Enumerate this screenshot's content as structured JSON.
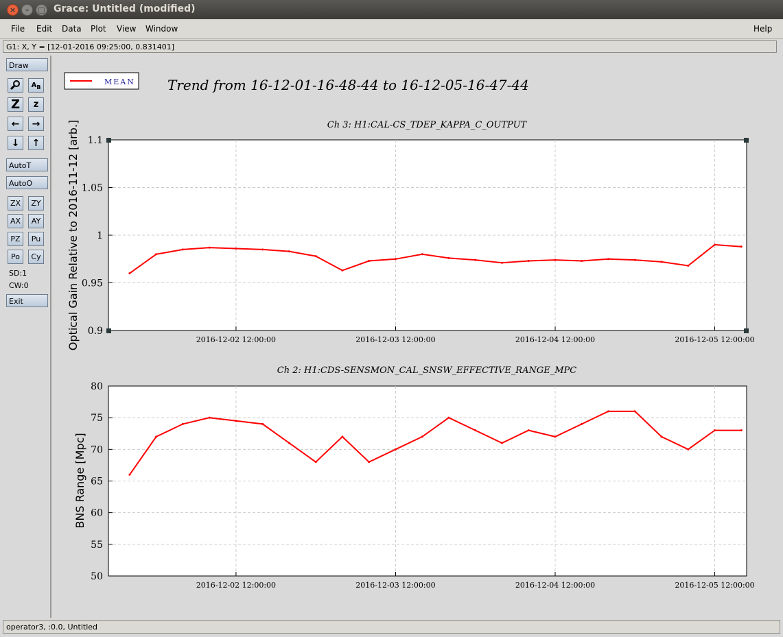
{
  "window": {
    "title": "Grace: Untitled (modified)"
  },
  "menu": {
    "file": "File",
    "edit": "Edit",
    "data": "Data",
    "plot": "Plot",
    "view": "View",
    "window": "Window",
    "help": "Help"
  },
  "coord_readout": "G1: X, Y = [12-01-2016 09:25:00, 0.831401]",
  "toolbar": {
    "draw": "Draw",
    "autot": "AutoT",
    "autoo": "AutoO",
    "zx": "ZX",
    "zy": "ZY",
    "ax": "AX",
    "ay": "AY",
    "pz": "PZ",
    "pu": "Pu",
    "po": "Po",
    "cy": "Cy",
    "sd": "SD:1",
    "cw": "CW:0",
    "exit": "Exit",
    "icons": [
      "zoom-icon",
      "autoscale-text-icon",
      "zoom-z-large-icon",
      "zoom-z-small-icon",
      "arrow-left-icon",
      "arrow-right-icon",
      "arrow-down-icon",
      "arrow-up-icon"
    ]
  },
  "status": "operator3, :0.0, Untitled",
  "figure": {
    "title": "Trend from 16-12-01-16-48-44 to 16-12-05-16-47-44",
    "legend": "MEAN",
    "line_color": "#ff0000"
  },
  "chart_data": [
    {
      "type": "line",
      "title": "Ch 3: H1:CAL-CS_TDEP_KAPPA_C_OUTPUT",
      "ylabel": "Optical Gain Relative to 2016-11-12 [arb.]",
      "xlabel": "",
      "ylim": [
        0.9,
        1.1
      ],
      "yticks": [
        "0.9",
        "0.95",
        "1",
        "1.05",
        "1.1"
      ],
      "xticks": [
        "2016-12-02 12:00:00",
        "2016-12-03 12:00:00",
        "2016-12-04 12:00:00",
        "2016-12-05 12:00:00"
      ],
      "grid": true,
      "series": [
        {
          "name": "MEAN",
          "x": [
            "2016-12-01 20:00",
            "2016-12-02 00:00",
            "2016-12-02 04:00",
            "2016-12-02 08:00",
            "2016-12-02 12:00",
            "2016-12-02 16:00",
            "2016-12-02 20:00",
            "2016-12-03 00:00",
            "2016-12-03 04:00",
            "2016-12-03 08:00",
            "2016-12-03 12:00",
            "2016-12-03 16:00",
            "2016-12-03 20:00",
            "2016-12-04 00:00",
            "2016-12-04 04:00",
            "2016-12-04 08:00",
            "2016-12-04 12:00",
            "2016-12-04 16:00",
            "2016-12-04 20:00",
            "2016-12-05 00:00",
            "2016-12-05 04:00",
            "2016-12-05 08:00",
            "2016-12-05 12:00",
            "2016-12-05 16:00"
          ],
          "values": [
            0.96,
            0.98,
            0.985,
            0.987,
            0.986,
            0.985,
            0.983,
            0.978,
            0.963,
            0.973,
            0.975,
            0.98,
            0.976,
            0.974,
            0.971,
            0.973,
            0.974,
            0.973,
            0.975,
            0.974,
            0.972,
            0.968,
            0.99,
            0.988
          ]
        }
      ]
    },
    {
      "type": "line",
      "title": "Ch 2: H1:CDS-SENSMON_CAL_SNSW_EFFECTIVE_RANGE_MPC",
      "ylabel": "BNS Range [Mpc]",
      "xlabel": "",
      "ylim": [
        50,
        80
      ],
      "yticks": [
        "50",
        "55",
        "60",
        "65",
        "70",
        "75",
        "80"
      ],
      "xticks": [
        "2016-12-02 12:00:00",
        "2016-12-03 12:00:00",
        "2016-12-04 12:00:00",
        "2016-12-05 12:00:00"
      ],
      "grid": true,
      "series": [
        {
          "name": "MEAN",
          "x": [
            "2016-12-01 20:00",
            "2016-12-02 00:00",
            "2016-12-02 04:00",
            "2016-12-02 08:00",
            "2016-12-02 12:00",
            "2016-12-02 16:00",
            "2016-12-02 20:00",
            "2016-12-03 00:00",
            "2016-12-03 04:00",
            "2016-12-03 08:00",
            "2016-12-03 12:00",
            "2016-12-03 16:00",
            "2016-12-03 20:00",
            "2016-12-04 00:00",
            "2016-12-04 04:00",
            "2016-12-04 08:00",
            "2016-12-04 12:00",
            "2016-12-04 16:00",
            "2016-12-04 20:00",
            "2016-12-05 00:00",
            "2016-12-05 04:00",
            "2016-12-05 08:00",
            "2016-12-05 12:00",
            "2016-12-05 16:00"
          ],
          "values": [
            66,
            72,
            74,
            75,
            74.5,
            74,
            71,
            68,
            72,
            68,
            70,
            72,
            75,
            73,
            71,
            73,
            72,
            74,
            76,
            76,
            72,
            70,
            73,
            73
          ]
        }
      ]
    }
  ]
}
